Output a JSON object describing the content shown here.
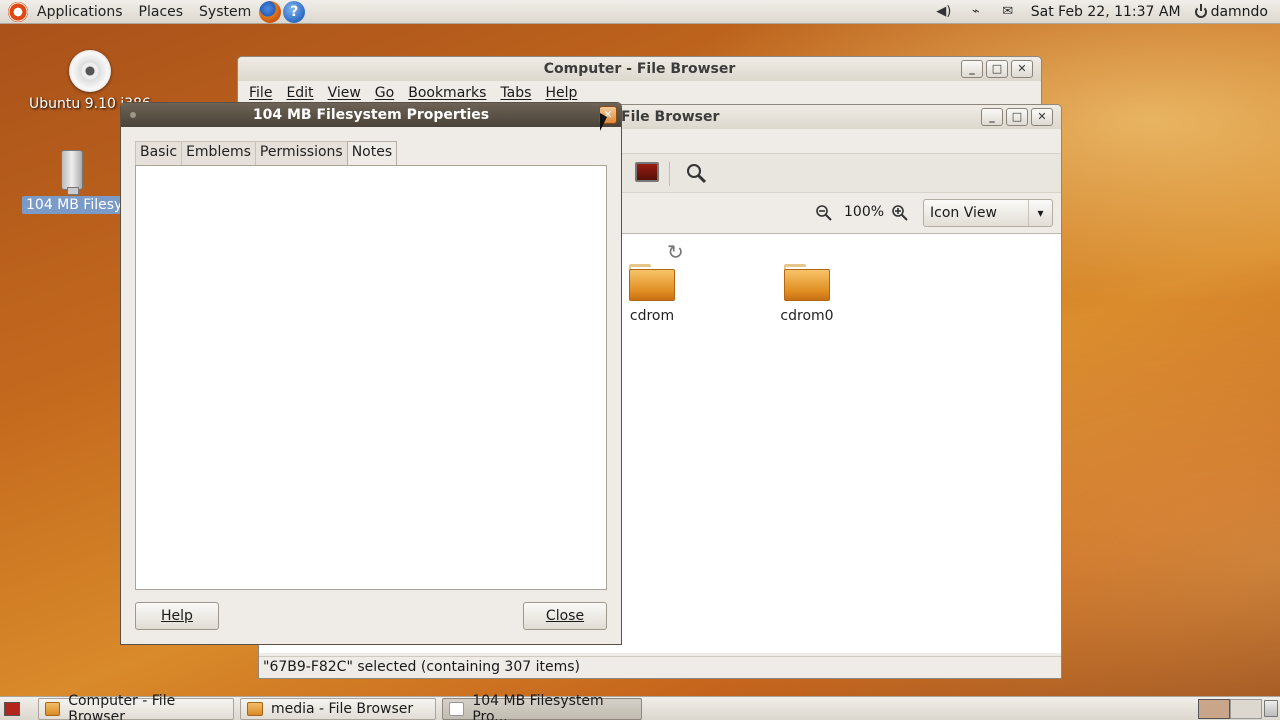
{
  "top_panel": {
    "menus": [
      "Applications",
      "Places",
      "System"
    ],
    "clock": "Sat Feb 22, 11:37 AM",
    "user": "damndo",
    "tray_icons": [
      "volume-icon",
      "network-icon",
      "mail-icon"
    ]
  },
  "desktop": {
    "icons": [
      {
        "label": "Ubuntu 9.10 i386",
        "icon": "cd-icon"
      },
      {
        "label": "104 MB Filesystem",
        "icon": "usb-drive-icon"
      }
    ]
  },
  "back_window": {
    "title": "Computer - File Browser",
    "menus": [
      "File",
      "Edit",
      "View",
      "Go",
      "Bookmarks",
      "Tabs",
      "Help"
    ]
  },
  "front_window": {
    "title": "media - File Browser",
    "title_visible": "File Browser",
    "zoom": "100%",
    "view_mode": "Icon View",
    "items": [
      {
        "label": "cdrom"
      },
      {
        "label": "cdrom0"
      }
    ],
    "status": "\"67B9-F82C\" selected (containing 307 items)"
  },
  "dialog": {
    "title": "104 MB Filesystem Properties",
    "tabs": [
      "Basic",
      "Emblems",
      "Permissions",
      "Notes"
    ],
    "active_tab": "Notes",
    "notes_text": "",
    "help_button": "Help",
    "close_button": "Close"
  },
  "bottom_panel": {
    "tasks": [
      {
        "label": "Computer - File Browser"
      },
      {
        "label": "media - File Browser"
      },
      {
        "label": "104 MB Filesystem Pro..."
      }
    ]
  }
}
